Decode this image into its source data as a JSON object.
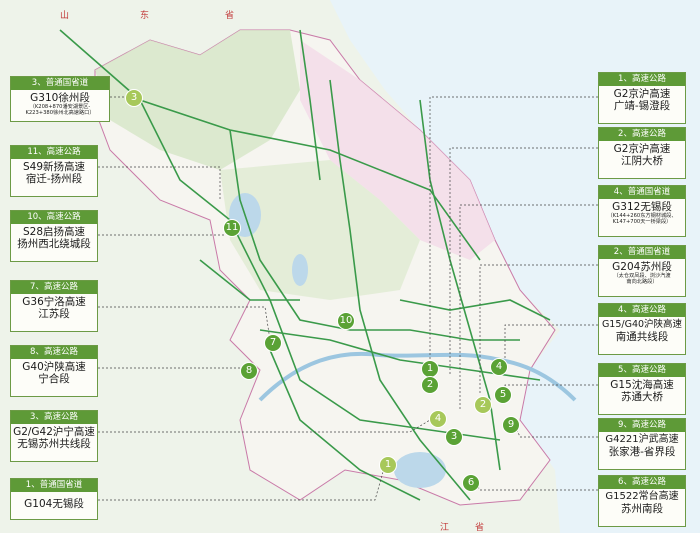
{
  "geo_labels": [
    "山",
    "东",
    "省",
    "江",
    "省"
  ],
  "cards": [
    {
      "header": "3、普通国省道",
      "title": "G310徐州段",
      "sub": "",
      "note1": "（K208+870潘安湖景区-",
      "note2": "K223+380徐州北高速路口）"
    },
    {
      "header": "11、高速公路",
      "title": "S49新扬高速",
      "sub": "宿迁-扬州段",
      "note1": "",
      "note2": ""
    },
    {
      "header": "10、高速公路",
      "title": "S28启扬高速",
      "sub": "扬州西北绕城段",
      "note1": "",
      "note2": ""
    },
    {
      "header": "7、高速公路",
      "title": "G36宁洛高速",
      "sub": "江苏段",
      "note1": "",
      "note2": ""
    },
    {
      "header": "8、高速公路",
      "title": "G40沪陕高速",
      "sub": "宁合段",
      "note1": "",
      "note2": ""
    },
    {
      "header": "3、高速公路",
      "title": "G2/G42沪宁高速",
      "sub": "无锡苏州共线段",
      "note1": "",
      "note2": ""
    },
    {
      "header": "1、普通国省道",
      "title": "G104无锡段",
      "sub": "",
      "note1": "",
      "note2": ""
    },
    {
      "header": "1、高速公路",
      "title": "G2京沪高速",
      "sub": "广靖-锡澄段",
      "note1": "",
      "note2": ""
    },
    {
      "header": "2、高速公路",
      "title": "G2京沪高速",
      "sub": "江阴大桥",
      "note1": "",
      "note2": ""
    },
    {
      "header": "4、普通国省道",
      "title": "G312无锡段",
      "sub": "",
      "note1": "（K144+260东方钢材城段、",
      "note2": "K147+700天一桥梁段）"
    },
    {
      "header": "2、普通国省道",
      "title": "G204苏州段",
      "sub": "",
      "note1": "（太仓双凤段、浏沙汽渡",
      "note2": "南向北路段）"
    },
    {
      "header": "4、高速公路",
      "title": "G15/G40沪陕高速",
      "sub": "南通共线段",
      "note1": "",
      "note2": ""
    },
    {
      "header": "5、高速公路",
      "title": "G15沈海高速",
      "sub": "苏通大桥",
      "note1": "",
      "note2": ""
    },
    {
      "header": "9、高速公路",
      "title": "G4221沪武高速",
      "sub": "张家港-省界段",
      "note1": "",
      "note2": ""
    },
    {
      "header": "6、高速公路",
      "title": "G1522常台高速",
      "sub": "苏州南段",
      "note1": "",
      "note2": ""
    }
  ],
  "markers": [
    "3",
    "11",
    "10",
    "7",
    "8",
    "1",
    "2",
    "1",
    "4",
    "2",
    "5",
    "4",
    "3",
    "9",
    "6",
    "1"
  ]
}
